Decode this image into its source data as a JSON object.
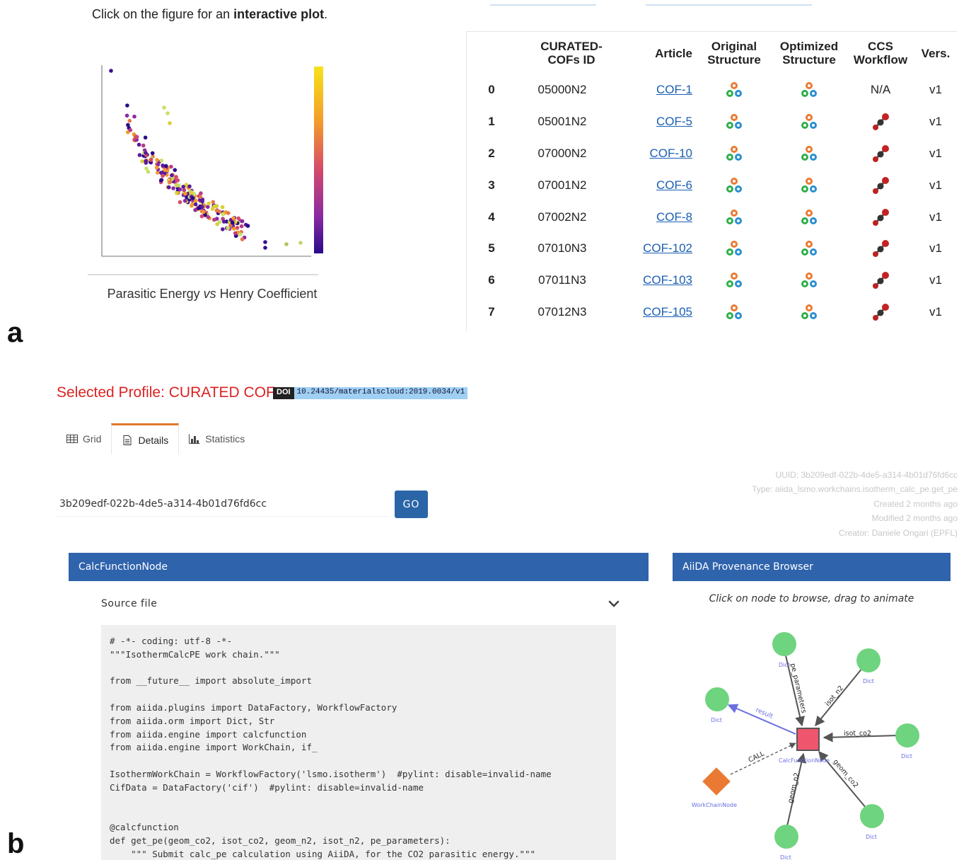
{
  "panel_a": {
    "letter": "a",
    "click_prefix": "Click on the figure for an ",
    "click_bold": "interactive plot",
    "click_suffix": ".",
    "plot_caption_pre": "Parasitic Energy ",
    "plot_caption_vs": "vs",
    "plot_caption_post": " Henry Coefficient",
    "table": {
      "headers": [
        "",
        "CURATED-COFs ID",
        "Article",
        "Original Structure",
        "Optimized Structure",
        "CCS Workflow",
        "Vers."
      ],
      "rows": [
        {
          "idx": "0",
          "id": "05000N2",
          "article": "COF-1",
          "workflow": "N/A",
          "ver": "v1"
        },
        {
          "idx": "1",
          "id": "05001N2",
          "article": "COF-5",
          "workflow": "icon",
          "ver": "v1"
        },
        {
          "idx": "2",
          "id": "07000N2",
          "article": "COF-10",
          "workflow": "icon",
          "ver": "v1"
        },
        {
          "idx": "3",
          "id": "07001N2",
          "article": "COF-6",
          "workflow": "icon",
          "ver": "v1"
        },
        {
          "idx": "4",
          "id": "07002N2",
          "article": "COF-8",
          "workflow": "icon",
          "ver": "v1"
        },
        {
          "idx": "5",
          "id": "07010N3",
          "article": "COF-102",
          "workflow": "icon",
          "ver": "v1"
        },
        {
          "idx": "6",
          "id": "07011N3",
          "article": "COF-103",
          "workflow": "icon",
          "ver": "v1"
        },
        {
          "idx": "7",
          "id": "07012N3",
          "article": "COF-105",
          "workflow": "icon",
          "ver": "v1"
        }
      ]
    }
  },
  "panel_b": {
    "letter": "b",
    "profile_title": "Selected Profile: CURATED COFs",
    "doi_label": "DOI",
    "doi_value": "10.24435/materialscloud:2019.0034/v1",
    "tabs": [
      {
        "label": "Grid",
        "icon": "grid-icon"
      },
      {
        "label": "Details",
        "icon": "document-icon",
        "active": true
      },
      {
        "label": "Statistics",
        "icon": "bar-chart-icon"
      }
    ],
    "meta": {
      "uuid": "UUID: 3b209edf-022b-4de5-a314-4b01d76fd6cc",
      "type": "Type: aiida_lsmo.workchains.isotherm_calc_pe.get_pe",
      "created": "Created 2 months ago",
      "modified": "Modified 2 months ago",
      "creator": "Creator: Daniele Ongari (EPFL)"
    },
    "uuid_input": "3b209edf-022b-4de5-a314-4b01d76fd6cc",
    "go_label": "GO",
    "node_panel_title": "CalcFunctionNode",
    "source_label": "Source file",
    "source_code": "# -*- coding: utf-8 -*-\n\"\"\"IsothermCalcPE work chain.\"\"\"\n\nfrom __future__ import absolute_import\n\nfrom aiida.plugins import DataFactory, WorkflowFactory\nfrom aiida.orm import Dict, Str\nfrom aiida.engine import calcfunction\nfrom aiida.engine import WorkChain, if_\n\nIsothermWorkChain = WorkflowFactory('lsmo.isotherm')  #pylint: disable=invalid-name\nCifData = DataFactory('cif')  #pylint: disable=invalid-name\n\n\n@calcfunction\ndef get_pe(geom_co2, isot_co2, geom_n2, isot_n2, pe_parameters):\n    \"\"\" Submit calc_pe calculation using AiiDA, for the CO2 parasitic energy.\"\"\"",
    "browser_title": "AiiDA Provenance Browser",
    "browser_hint": "Click on node to browse, drag to animate",
    "graph": {
      "center_label": "CalcFunctionNode",
      "workchain_label": "WorkChainNode",
      "dict_label": "Dict",
      "edges": {
        "pe_parameters": "pe_parameters",
        "isot_n2": "isot_n2",
        "isot_co2": "isot_co2",
        "geom_co2": "geom_co2",
        "geom_n2": "geom_n2",
        "result": "result",
        "call": "CALL"
      },
      "colors": {
        "dict": "#6fd47f",
        "center": "#f0556e",
        "workchain": "#ea7a33",
        "link": "#555555",
        "result": "#6a6ee0"
      }
    }
  }
}
